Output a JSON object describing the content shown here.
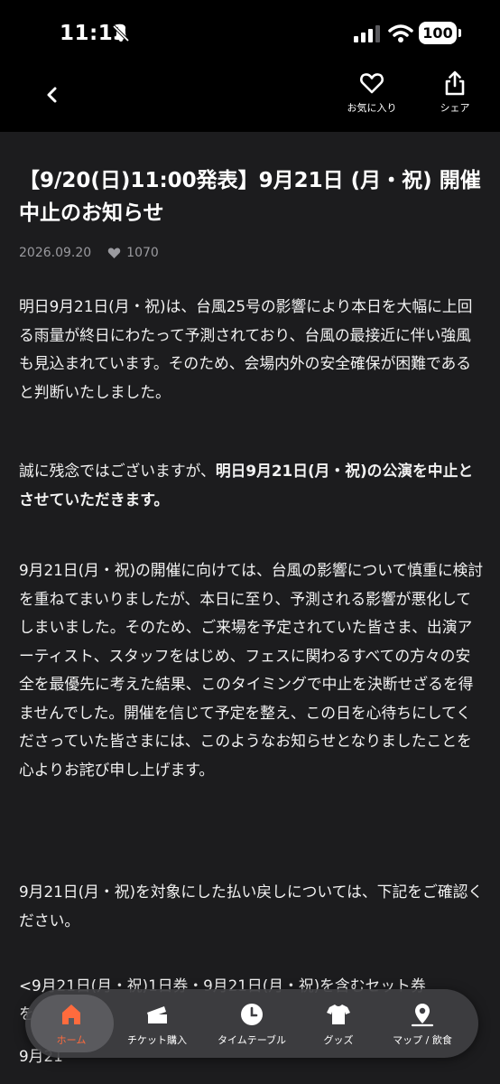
{
  "status_bar": {
    "time": "11:13",
    "battery": "100"
  },
  "nav": {
    "favorite_label": "お気に入り",
    "share_label": "シェア"
  },
  "article": {
    "title": "【9/20(日)11:00発表】9月21日 (月・祝) 開催中止のお知らせ",
    "date": "2026.09.20",
    "likes": "1070",
    "para1": "明日9月21日(月・祝)は、台風25号の影響により本日を大幅に上回る雨量が終日にわたって予測されており、台風の最接近に伴い強風も見込まれています。そのため、会場内外の安全確保が困難であると判断いたしました。",
    "para2_normal": "誠に残念ではございますが、",
    "para2_bold": "明日9月21日(月・祝)の公演を中止とさせていただきます。",
    "para3": "9月21日(月・祝)の開催に向けては、台風の影響について慎重に検討を重ねてまいりましたが、本日に至り、予測される影響が悪化してしまいました。そのため、ご来場を予定されていた皆さま、出演アーティスト、スタッフをはじめ、フェスに関わるすべての方々の安全を最優先に考えた結果、このタイミングで中止を決断せざるを得ませんでした。開催を信じて予定を整え、この日を心待ちにしてくださっていた皆さまには、このようなお知らせとなりましたことを心よりお詫び申し上げます。",
    "para4": "9月21日(月・祝)を対象にした払い戻しについては、下記をご確認ください。",
    "para5": "<9月21日(月・祝)1日券・9月21日(月・祝)を含むセット券",
    "para6": "を",
    "para7": "9月21"
  },
  "tabs": {
    "home": "ホーム",
    "ticket": "チケット購入",
    "timetable": "タイムテーブル",
    "goods": "グッズ",
    "map": "マップ / 飲食"
  },
  "colors": {
    "accent": "#ff6b3d",
    "background": "#1c1c1e",
    "header": "#000000"
  }
}
